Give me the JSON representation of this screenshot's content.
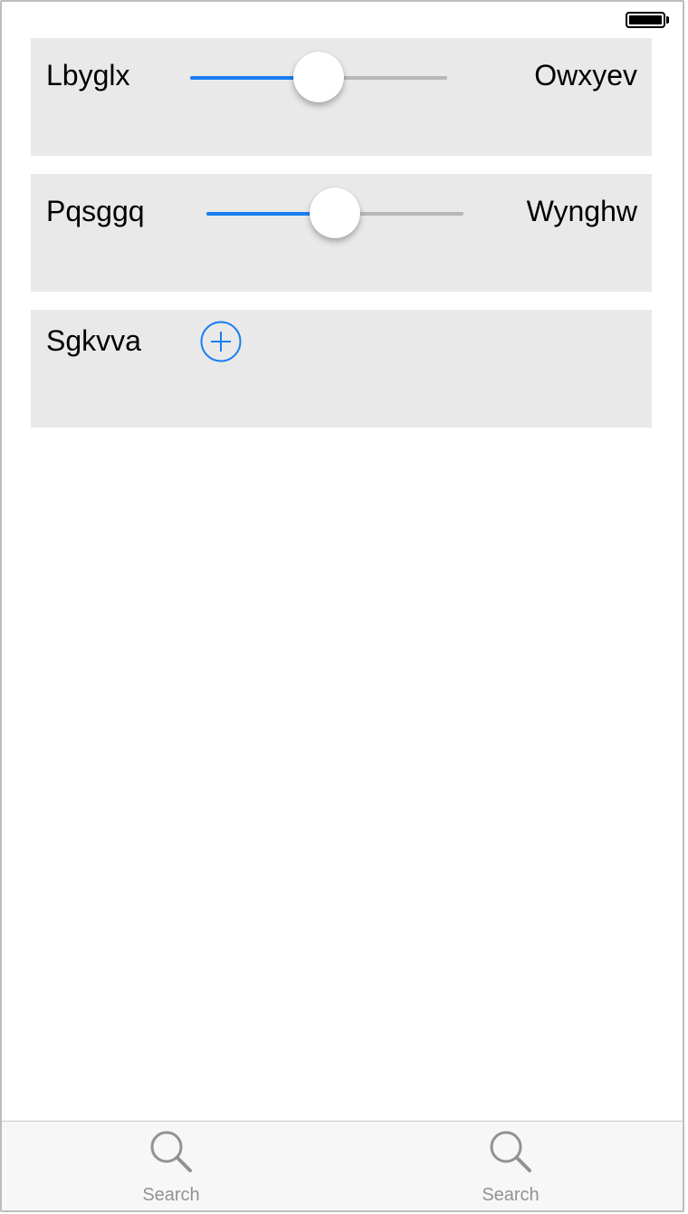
{
  "status_bar": {
    "battery_level": 1.0
  },
  "sliders": [
    {
      "left_label": "Lbyglx",
      "right_label": "Owxyev",
      "value": 0.5
    },
    {
      "left_label": "Pqsggq",
      "right_label": "Wynghw",
      "value": 0.5
    }
  ],
  "stepper_row": {
    "label": "Sgkvva",
    "button_icon": "plus-circle-icon"
  },
  "tabs": [
    {
      "label": "Search",
      "icon": "search-icon"
    },
    {
      "label": "Search",
      "icon": "search-icon"
    }
  ],
  "colors": {
    "accent": "#1a7ef2",
    "panel_background": "#e9e9e9",
    "track_inactive": "#b7b7b7",
    "tab_inactive": "#929292"
  }
}
